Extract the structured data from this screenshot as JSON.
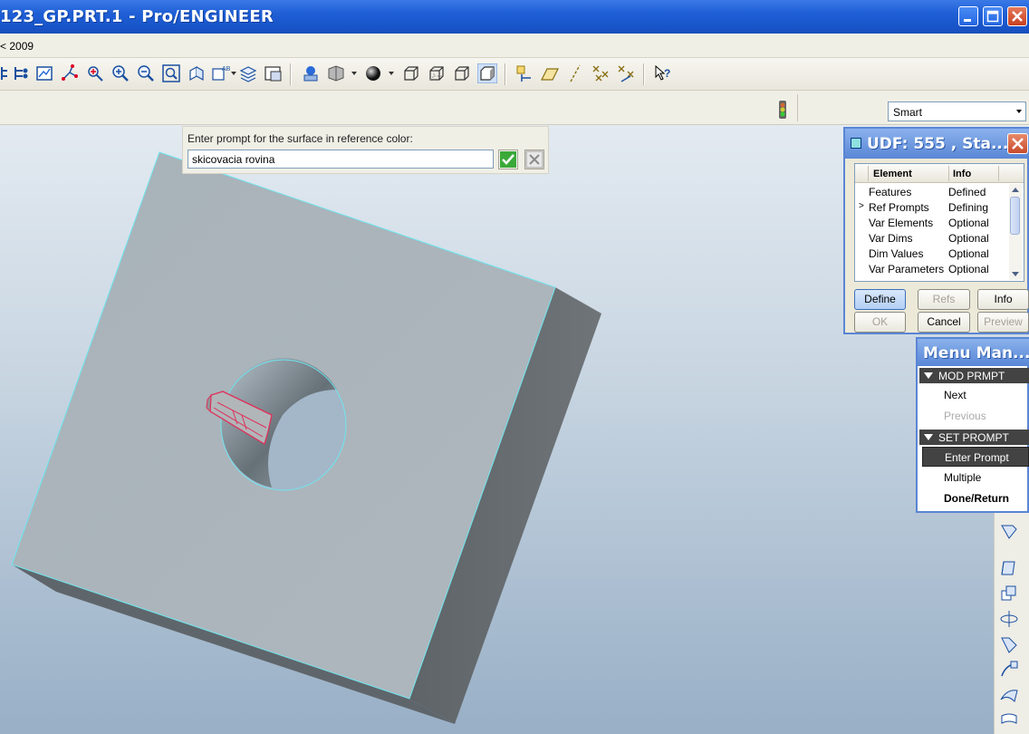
{
  "window": {
    "title": "123_GP.PRT.1 - Pro/ENGINEER"
  },
  "menubar": {
    "item": "< 2009"
  },
  "smart_select": {
    "value": "Smart"
  },
  "prompt": {
    "label": "Enter prompt for the surface in reference color:",
    "value": "skicovacia rovina"
  },
  "udf_dialog": {
    "title": "UDF: 555 , Sta...",
    "columns": [
      "Element",
      "Info"
    ],
    "rows": [
      {
        "element": "Features",
        "info": "Defined",
        "marker": ""
      },
      {
        "element": "Ref Prompts",
        "info": "Defining",
        "marker": ">"
      },
      {
        "element": "Var Elements",
        "info": "Optional",
        "marker": ""
      },
      {
        "element": "Var Dims",
        "info": "Optional",
        "marker": ""
      },
      {
        "element": "Dim Values",
        "info": "Optional",
        "marker": ""
      },
      {
        "element": "Var Parameters",
        "info": "Optional",
        "marker": ""
      }
    ],
    "buttons": {
      "define": "Define",
      "refs": "Refs",
      "info": "Info",
      "ok": "OK",
      "cancel": "Cancel",
      "preview": "Preview"
    }
  },
  "menu_manager": {
    "title": "Menu Man...",
    "sections": [
      {
        "title": "MOD PRMPT",
        "items": [
          {
            "label": "Next",
            "state": "normal"
          },
          {
            "label": "Previous",
            "state": "disabled"
          }
        ]
      },
      {
        "title": "SET PROMPT",
        "items": [
          {
            "label": "Enter Prompt",
            "state": "selected"
          },
          {
            "label": "Multiple",
            "state": "normal"
          },
          {
            "label": "Done/Return",
            "state": "bold"
          }
        ]
      }
    ]
  },
  "colors": {
    "title_bar": "#1f5fd6",
    "model_top_face": "#a9b3b9",
    "model_side_face": "#666b70",
    "edge_highlight": "#6fe6f0",
    "selected_feature": "#e0305a",
    "menu_selected_bg": "#434343"
  }
}
